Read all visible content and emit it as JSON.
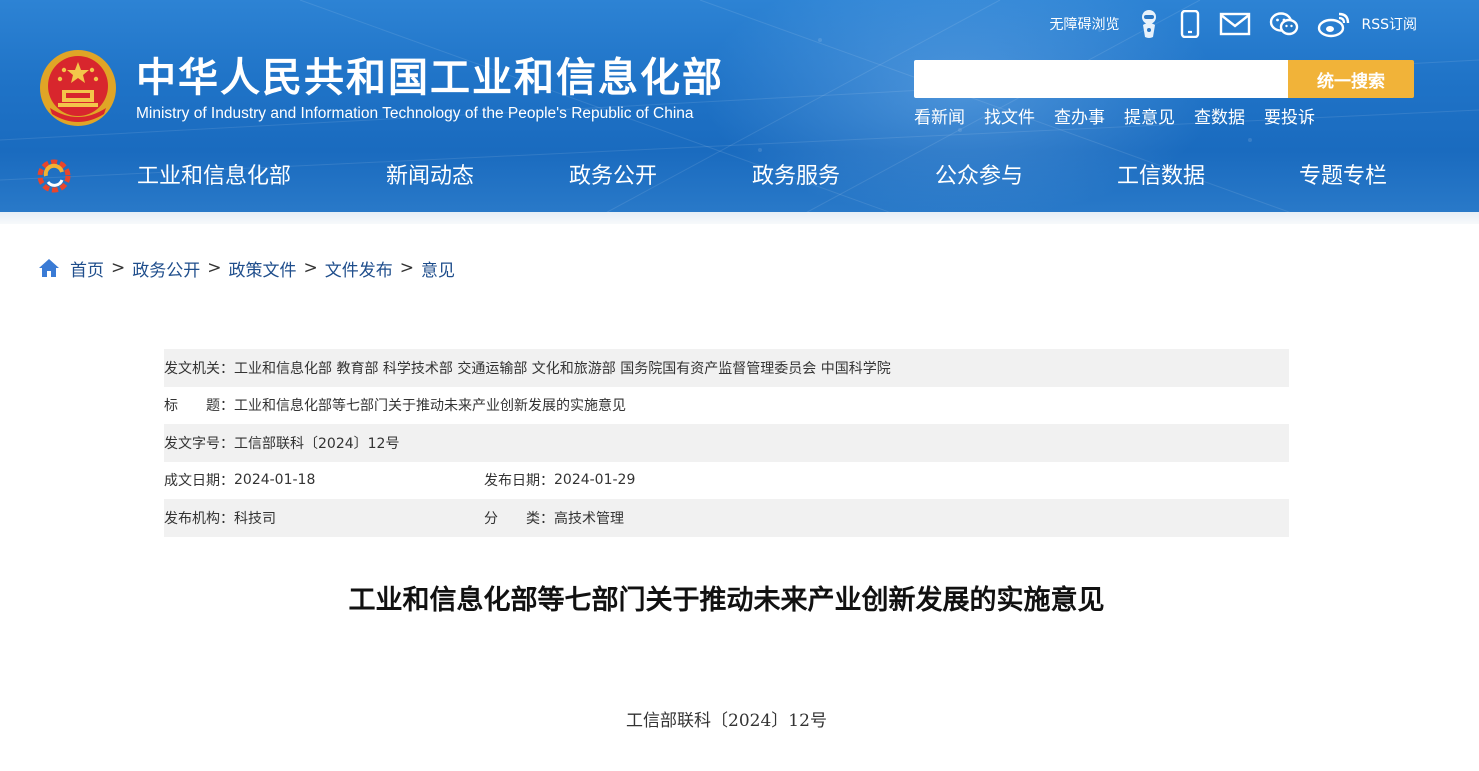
{
  "header": {
    "site_title": "中华人民共和国工业和信息化部",
    "site_subtitle": "Ministry of Industry and Information Technology of the People's Republic of China",
    "top_tools": {
      "accessibility": "无障碍浏览",
      "rss": "RSS订阅"
    },
    "search": {
      "placeholder": "",
      "button_label": "统一搜索"
    },
    "quick_links": [
      "看新闻",
      "找文件",
      "查办事",
      "提意见",
      "查数据",
      "要投诉"
    ],
    "nav": [
      "工业和信息化部",
      "新闻动态",
      "政务公开",
      "政务服务",
      "公众参与",
      "工信数据",
      "专题专栏"
    ],
    "colors": {
      "header_blue": "#1f73c7",
      "search_button": "#f1b339",
      "link_blue": "#1f4e8c"
    }
  },
  "breadcrumb": [
    "首页",
    "政务公开",
    "政策文件",
    "文件发布",
    "意见"
  ],
  "info": {
    "issuer_label": "发文机关：",
    "issuer_value": "工业和信息化部 教育部 科学技术部 交通运输部 文化和旅游部 国务院国有资产监督管理委员会 中国科学院",
    "title_label": "标　　题：",
    "title_value": "工业和信息化部等七部门关于推动未来产业创新发展的实施意见",
    "docno_label": "发文字号：",
    "docno_value": "工信部联科〔2024〕12号",
    "date_label": "成文日期：",
    "date_value": "2024-01-18",
    "pubdate_label": "发布日期：",
    "pubdate_value": "2024-01-29",
    "org_label": "发布机构：",
    "org_value": "科技司",
    "class_label": "分　　类：",
    "class_value": "高技术管理"
  },
  "article": {
    "title": "工业和信息化部等七部门关于推动未来产业创新发展的实施意见",
    "doc_number": "工信部联科〔2024〕12号"
  }
}
